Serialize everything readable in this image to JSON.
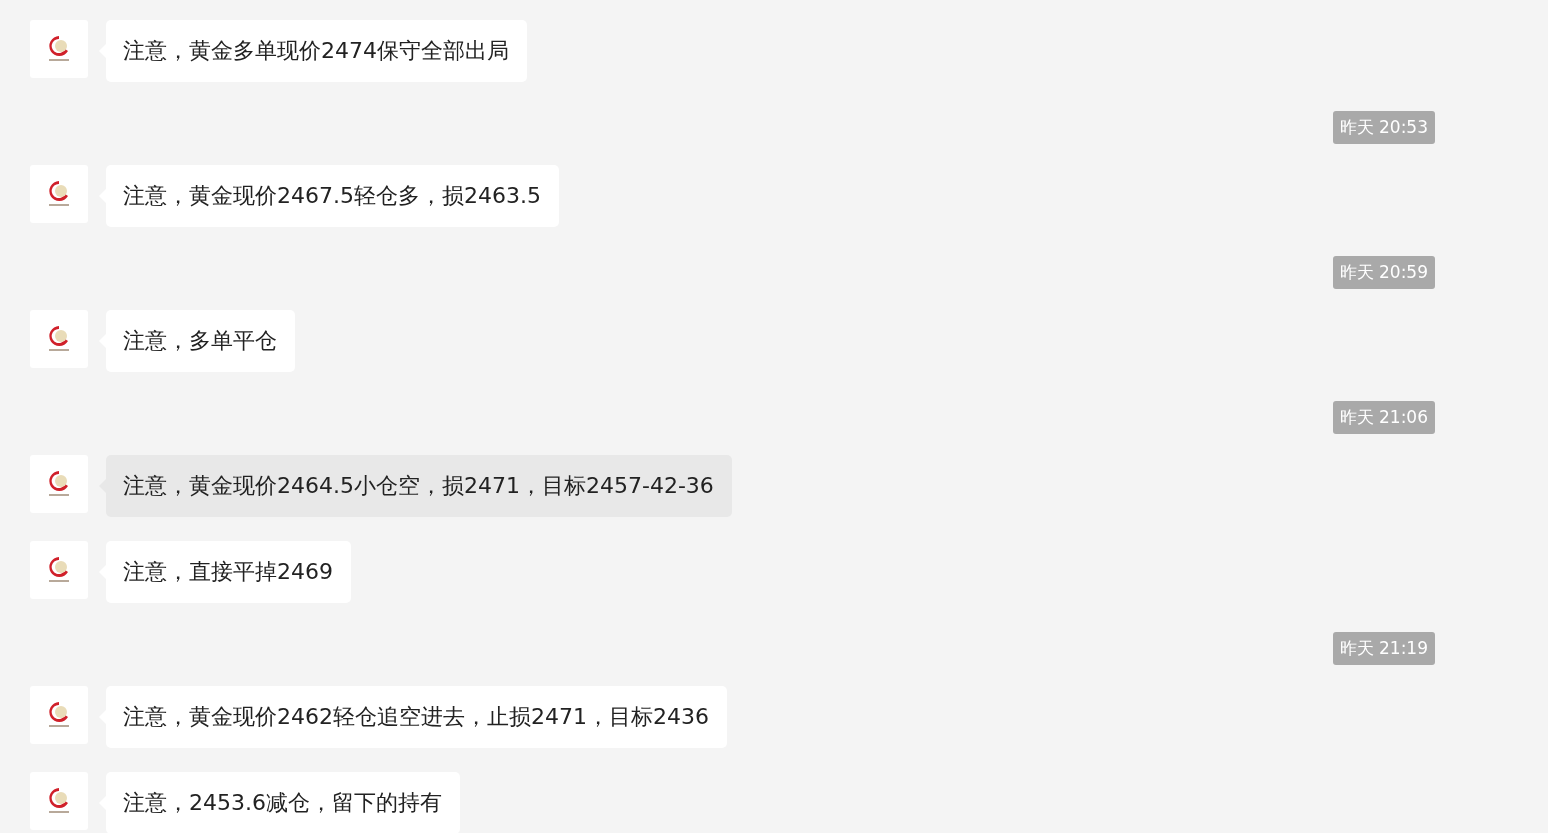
{
  "messages": [
    {
      "kind": "message",
      "text": "注意，黄金多单现价2474保守全部出局",
      "highlighted": false
    },
    {
      "kind": "time",
      "text": "昨天 20:53"
    },
    {
      "kind": "message",
      "text": "注意，黄金现价2467.5轻仓多，损2463.5",
      "highlighted": false
    },
    {
      "kind": "time",
      "text": "昨天 20:59"
    },
    {
      "kind": "message",
      "text": "注意，多单平仓",
      "highlighted": false
    },
    {
      "kind": "time",
      "text": "昨天 21:06"
    },
    {
      "kind": "message",
      "text": "注意，黄金现价2464.5小仓空，损2471，目标2457-42-36",
      "highlighted": true
    },
    {
      "kind": "message",
      "text": "注意，直接平掉2469",
      "highlighted": false
    },
    {
      "kind": "time",
      "text": "昨天 21:19"
    },
    {
      "kind": "message",
      "text": "注意，黄金现价2462轻仓追空进去，止损2471，目标2436",
      "highlighted": false
    },
    {
      "kind": "message",
      "text": "注意，2453.6减仓，留下的持有",
      "highlighted": false
    }
  ]
}
